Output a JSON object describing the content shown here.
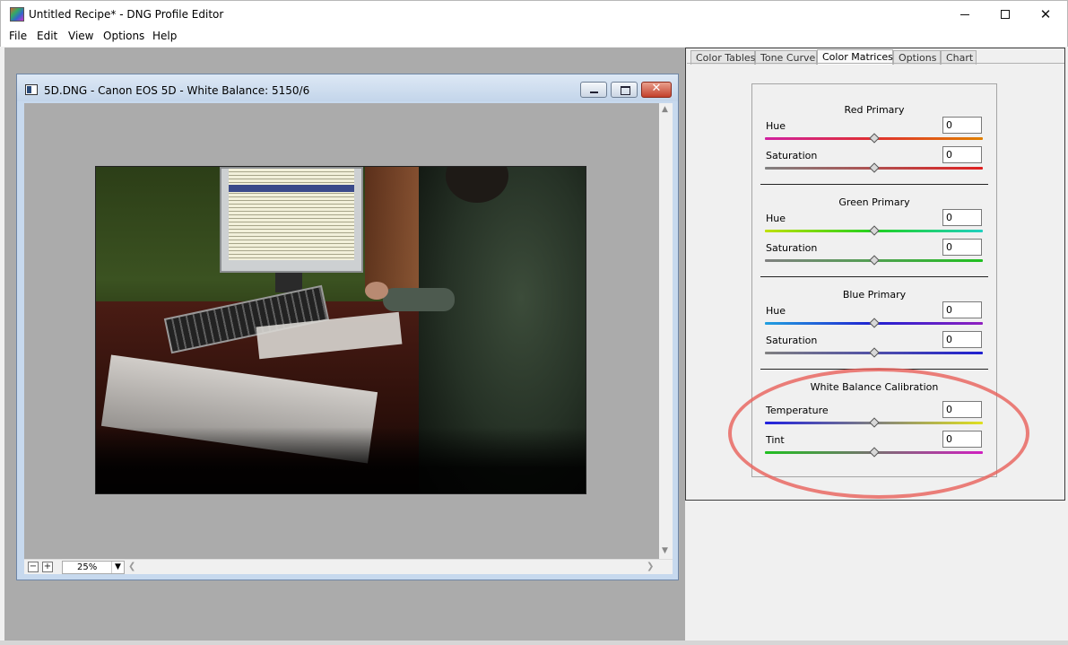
{
  "app": {
    "title": "Untitled Recipe* - DNG Profile Editor",
    "menu": [
      "File",
      "Edit",
      "View",
      "Options",
      "Help"
    ]
  },
  "image_window": {
    "title": "5D.DNG  - Canon EOS 5D - White Balance: 5150/6",
    "zoom": "25%",
    "zoom_out": "−",
    "zoom_in": "+"
  },
  "tabs": [
    "Color Tables",
    "Tone Curve",
    "Color Matrices",
    "Options",
    "Chart"
  ],
  "active_tab": "Color Matrices",
  "sections": {
    "red": {
      "title": "Red Primary",
      "hue_label": "Hue",
      "hue_value": "0",
      "sat_label": "Saturation",
      "sat_value": "0"
    },
    "green": {
      "title": "Green Primary",
      "hue_label": "Hue",
      "hue_value": "0",
      "sat_label": "Saturation",
      "sat_value": "0"
    },
    "blue": {
      "title": "Blue Primary",
      "hue_label": "Hue",
      "hue_value": "0",
      "sat_label": "Saturation",
      "sat_value": "0"
    },
    "wb": {
      "title": "White Balance Calibration",
      "temp_label": "Temperature",
      "temp_value": "0",
      "tint_label": "Tint",
      "tint_value": "0"
    }
  },
  "colors": {
    "annotation": "#e8605a",
    "red_hue_gradient": [
      "#d020a0",
      "#e03030",
      "#e08000"
    ],
    "red_sat_gradient": [
      "#808080",
      "#e02020"
    ],
    "green_hue_gradient": [
      "#c0e000",
      "#20d020",
      "#20d0c0"
    ],
    "green_sat_gradient": [
      "#808080",
      "#20c020"
    ],
    "blue_hue_gradient": [
      "#20a0e0",
      "#2020d0",
      "#9020c0"
    ],
    "blue_sat_gradient": [
      "#808080",
      "#2020d0"
    ],
    "temp_gradient": [
      "#2020e0",
      "#e0e020"
    ],
    "tint_gradient": [
      "#20c020",
      "#d020c0"
    ]
  }
}
